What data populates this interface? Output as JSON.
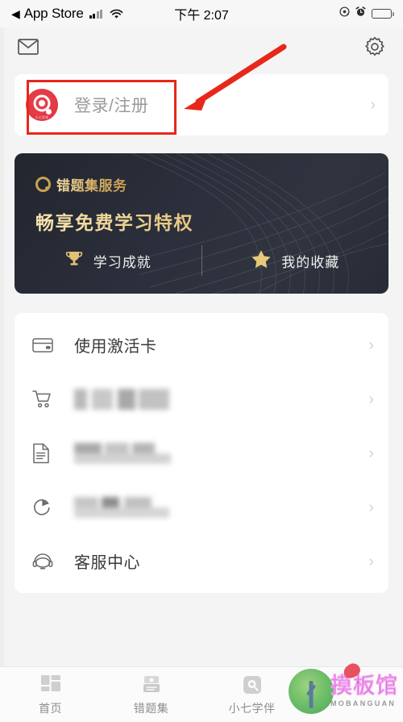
{
  "status_bar": {
    "back_glyph": "◀",
    "back_app": "App Store",
    "time": "下午 2:07",
    "signal_icon": "signal-bars-icon",
    "wifi_icon": "wifi-icon",
    "location_icon": "location-icon",
    "alarm_icon": "alarm-icon",
    "battery_icon": "battery-charging-icon"
  },
  "topbar": {
    "mail_icon": "mail-icon",
    "settings_icon": "gear-icon"
  },
  "login": {
    "label": "登录/注册",
    "avatar_icon": "app-logo-avatar",
    "avatar_mark": "小七学伴",
    "chevron": "›"
  },
  "annotation": {
    "box_color": "#e8271a",
    "arrow_color": "#e8271a"
  },
  "promo": {
    "brand_icon": "gold-q-icon",
    "brand": "错题集服务",
    "title": "畅享免费学习特权",
    "actions": [
      {
        "icon": "trophy-icon",
        "label": "学习成就"
      },
      {
        "icon": "star-icon",
        "label": "我的收藏"
      }
    ]
  },
  "menu": {
    "rows": [
      {
        "icon": "card-icon",
        "label": "使用激活卡",
        "blurred": false,
        "chevron": "›"
      },
      {
        "icon": "cart-icon",
        "label": "",
        "blurred": true,
        "chevron": "›"
      },
      {
        "icon": "document-icon",
        "label": "",
        "blurred": true,
        "chevron": "›"
      },
      {
        "icon": "refresh-icon",
        "label": "",
        "blurred": true,
        "chevron": "›"
      },
      {
        "icon": "headset-icon",
        "label": "客服中心",
        "blurred": false,
        "chevron": "›"
      }
    ]
  },
  "tabbar": {
    "items": [
      {
        "icon": "home-grid-icon",
        "label": "首页",
        "active": false
      },
      {
        "icon": "notebook-icon",
        "label": "错题集",
        "active": false
      },
      {
        "icon": "camera-scan-icon",
        "label": "小七学伴",
        "active": false
      }
    ]
  },
  "watermark": {
    "cn": "摸板馆",
    "en": "MOBANGUAN",
    "tree_icon": "tree-logo-icon"
  },
  "colors": {
    "brand_red": "#e23b46",
    "annotation_red": "#e8271a",
    "banner_bg": "#2b2f3b",
    "gold": "#d9b36a",
    "page_bg": "#f4f4f4",
    "card_bg": "#ffffff",
    "battery_green": "#4cd964"
  }
}
